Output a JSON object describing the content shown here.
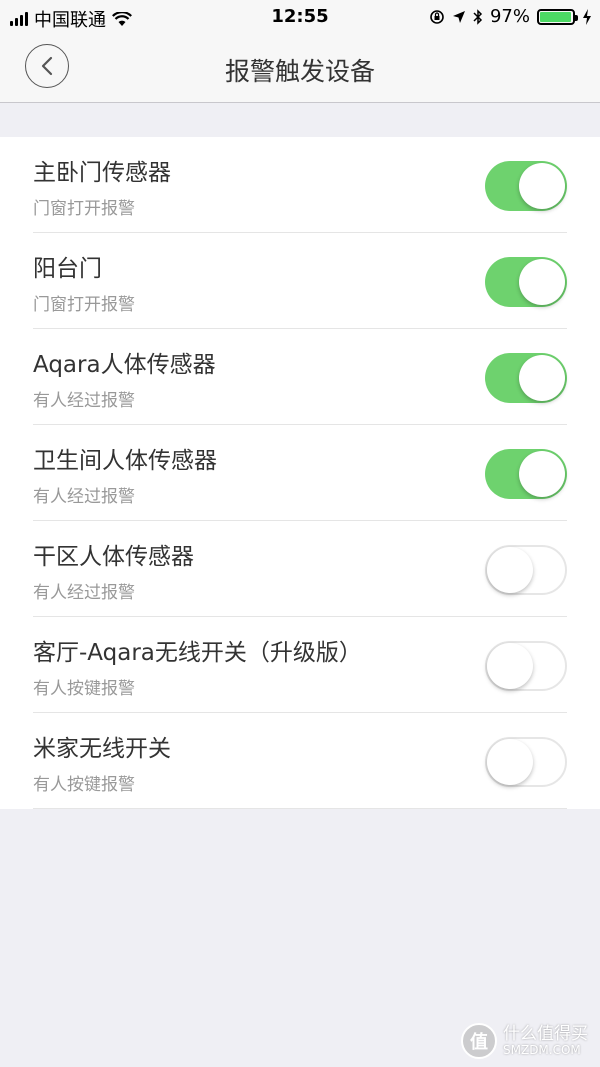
{
  "status_bar": {
    "carrier": "中国联通",
    "time": "12:55",
    "battery": "97%",
    "battery_level": 0.97
  },
  "nav": {
    "title": "报警触发设备"
  },
  "devices": [
    {
      "name": "主卧门传感器",
      "trigger": "门窗打开报警",
      "enabled": true
    },
    {
      "name": "阳台门",
      "trigger": "门窗打开报警",
      "enabled": true
    },
    {
      "name": "Aqara人体传感器",
      "trigger": "有人经过报警",
      "enabled": true
    },
    {
      "name": "卫生间人体传感器",
      "trigger": "有人经过报警",
      "enabled": true
    },
    {
      "name": "干区人体传感器",
      "trigger": "有人经过报警",
      "enabled": false
    },
    {
      "name": "客厅-Aqara无线开关（升级版）",
      "trigger": "有人按键报警",
      "enabled": false
    },
    {
      "name": "米家无线开关",
      "trigger": "有人按键报警",
      "enabled": false
    }
  ],
  "colors": {
    "toggle_on": "#6ed26e",
    "background": "#efeff4"
  },
  "watermark": {
    "text_cn": "什么值得买",
    "text_en": "SMZDM.COM",
    "logo_char": "值"
  }
}
